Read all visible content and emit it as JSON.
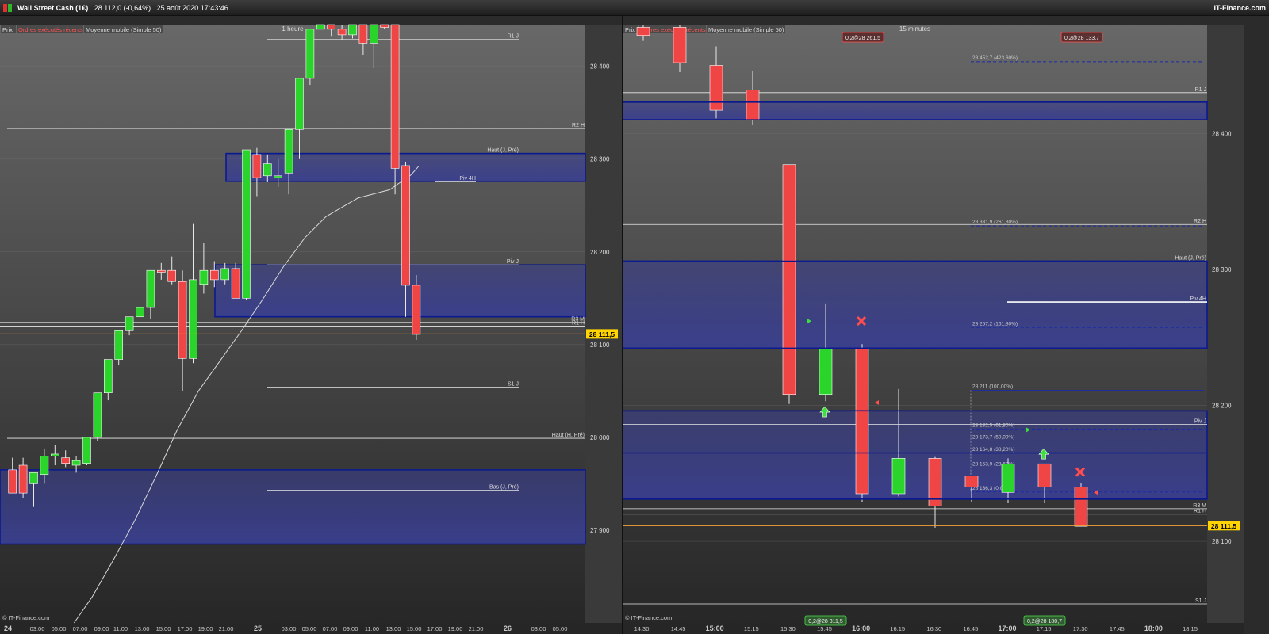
{
  "header": {
    "instrument": "Wall Street Cash (1€)",
    "price": "28 112,0",
    "change": "(-0,64%)",
    "datetime": "25 août 2020 17:43:46",
    "brand": "IT-Finance.com"
  },
  "colors": {
    "up": "#2bd42b",
    "down": "#f04545",
    "band": "#3a3f90",
    "pivot_line": "#0c1a8f",
    "last_price": "#f5a23a",
    "price_tag": "#ffd400"
  },
  "watermark": "© IT-Finance.com",
  "chart_data": [
    {
      "type": "candlestick",
      "title": "1 heure",
      "legend": [
        "Prix",
        "Ordres exécutés récents",
        "Moyenne mobile (Simple 50)"
      ],
      "last_price_label": "28 111,5",
      "y_ticks": [
        27900,
        28000,
        28100,
        28200,
        28300,
        28400
      ],
      "y_tick_labels": [
        "27 900",
        "28 000",
        "28 100",
        "28 200",
        "28 300",
        "28 400"
      ],
      "ylim": [
        27800,
        28445
      ],
      "x_tick_labels": [
        "24",
        "03:00",
        "05:00",
        "07:00",
        "09:00",
        "11:00",
        "13:00",
        "15:00",
        "17:00",
        "19:00",
        "21:00",
        "25",
        "03:00",
        "05:00",
        "07:00",
        "09:00",
        "11:00",
        "13:00",
        "15:00",
        "17:00",
        "19:00",
        "21:00",
        "26",
        "03:00",
        "05:00"
      ],
      "candles": [
        {
          "o": 27965,
          "h": 27978,
          "l": 27942,
          "c": 27940
        },
        {
          "o": 27970,
          "h": 27978,
          "l": 27935,
          "c": 27940
        },
        {
          "o": 27950,
          "h": 27962,
          "l": 27925,
          "c": 27962
        },
        {
          "o": 27960,
          "h": 27988,
          "l": 27950,
          "c": 27980
        },
        {
          "o": 27980,
          "h": 27992,
          "l": 27970,
          "c": 27982
        },
        {
          "o": 27978,
          "h": 27986,
          "l": 27968,
          "c": 27972
        },
        {
          "o": 27970,
          "h": 27980,
          "l": 27962,
          "c": 27975
        },
        {
          "o": 27972,
          "h": 28000,
          "l": 27970,
          "c": 28000
        },
        {
          "o": 28000,
          "h": 28020,
          "l": 27996,
          "c": 28048
        },
        {
          "o": 28048,
          "h": 28060,
          "l": 28040,
          "c": 28084
        },
        {
          "o": 28084,
          "h": 28100,
          "l": 28078,
          "c": 28115
        },
        {
          "o": 28115,
          "h": 28130,
          "l": 28110,
          "c": 28130
        },
        {
          "o": 28130,
          "h": 28145,
          "l": 28120,
          "c": 28140
        },
        {
          "o": 28140,
          "h": 28175,
          "l": 28128,
          "c": 28180
        },
        {
          "o": 28180,
          "h": 28188,
          "l": 28170,
          "c": 28178
        },
        {
          "o": 28180,
          "h": 28195,
          "l": 28165,
          "c": 28168
        },
        {
          "o": 28168,
          "h": 28180,
          "l": 28050,
          "c": 28085
        },
        {
          "o": 28085,
          "h": 28230,
          "l": 28080,
          "c": 28170
        },
        {
          "o": 28165,
          "h": 28210,
          "l": 28155,
          "c": 28180
        },
        {
          "o": 28180,
          "h": 28190,
          "l": 28162,
          "c": 28170
        },
        {
          "o": 28170,
          "h": 28188,
          "l": 28165,
          "c": 28182
        },
        {
          "o": 28182,
          "h": 28188,
          "l": 28160,
          "c": 28150
        },
        {
          "o": 28150,
          "h": 28310,
          "l": 28148,
          "c": 28310
        },
        {
          "o": 28305,
          "h": 28312,
          "l": 28260,
          "c": 28280
        },
        {
          "o": 28282,
          "h": 28305,
          "l": 28275,
          "c": 28295
        },
        {
          "o": 28280,
          "h": 28300,
          "l": 28270,
          "c": 28282
        },
        {
          "o": 28285,
          "h": 28332,
          "l": 28262,
          "c": 28332
        },
        {
          "o": 28332,
          "h": 28340,
          "l": 28300,
          "c": 28387
        },
        {
          "o": 28387,
          "h": 28440,
          "l": 28380,
          "c": 28440
        },
        {
          "o": 28440,
          "h": 28445,
          "l": 28440,
          "c": 28445
        },
        {
          "o": 28445,
          "h": 28445,
          "l": 28432,
          "c": 28440
        },
        {
          "o": 28440,
          "h": 28445,
          "l": 28428,
          "c": 28434
        },
        {
          "o": 28434,
          "h": 28445,
          "l": 28430,
          "c": 28445
        },
        {
          "o": 28445,
          "h": 28445,
          "l": 28412,
          "c": 28425
        },
        {
          "o": 28425,
          "h": 28445,
          "l": 28398,
          "c": 28445
        },
        {
          "o": 28445,
          "h": 28445,
          "l": 28440,
          "c": 28442
        },
        {
          "o": 28445,
          "h": 28445,
          "l": 28262,
          "c": 28290
        },
        {
          "o": 28293,
          "h": 28297,
          "l": 28130,
          "c": 28164
        },
        {
          "o": 28164,
          "h": 28175,
          "l": 28105,
          "c": 28111
        }
      ],
      "moving_average": [
        [
          6.3,
          27800
        ],
        [
          8,
          27828
        ],
        [
          10,
          27868
        ],
        [
          12,
          27910
        ],
        [
          14,
          27958
        ],
        [
          16,
          28008
        ],
        [
          18,
          28050
        ],
        [
          20,
          28082
        ],
        [
          22,
          28114
        ],
        [
          24,
          28148
        ],
        [
          26,
          28184
        ],
        [
          28,
          28215
        ],
        [
          30,
          28238
        ],
        [
          33,
          28258
        ],
        [
          36,
          28267
        ],
        [
          38,
          28283
        ],
        [
          38.7,
          28292
        ]
      ],
      "levels": [
        {
          "label": "R1 J",
          "value": 28429
        },
        {
          "label": "R2 H",
          "value": 28333
        },
        {
          "label": "Haut (J, Pré)",
          "value": 28306
        },
        {
          "label": "Piv 4H",
          "value": 28276
        },
        {
          "label": "Piv J",
          "value": 28186
        },
        {
          "label": "R3 M",
          "value": 28124
        },
        {
          "label": "R1 H",
          "value": 28120
        },
        {
          "label": "S1 J",
          "value": 28054
        },
        {
          "label": "Haut (H, Pré)",
          "value": 27999
        },
        {
          "label": "Bas (J, Pré)",
          "value": 27943
        }
      ]
    },
    {
      "type": "candlestick",
      "title": "15 minutes",
      "legend": [
        "Prix",
        "Ordres exécutés récents",
        "Moyenne mobile (Simple 50)"
      ],
      "last_price_label": "28 111,5",
      "y_ticks": [
        28100,
        28200,
        28300,
        28400
      ],
      "y_tick_labels": [
        "28 100",
        "28 200",
        "28 300",
        "28 400"
      ],
      "ylim": [
        28040,
        28480
      ],
      "x_tick_labels": [
        "14:30",
        "14:45",
        "15:00",
        "15:15",
        "15:30",
        "15:45",
        "16:00",
        "16:15",
        "16:30",
        "16:45",
        "17:00",
        "17:15",
        "17:30",
        "17:45",
        "18:00",
        "18:15"
      ],
      "candles": [
        {
          "o": 28478,
          "h": 28480,
          "l": 28468,
          "c": 28472
        },
        {
          "o": 28478,
          "h": 28480,
          "l": 28445,
          "c": 28452
        },
        {
          "o": 28450,
          "h": 28464,
          "l": 28411,
          "c": 28417
        },
        {
          "o": 28432,
          "h": 28446,
          "l": 28406,
          "c": 28410
        },
        {
          "o": 28377,
          "h": 28377,
          "l": 28201,
          "c": 28208
        },
        {
          "o": 28208,
          "h": 28275,
          "l": 28203,
          "c": 28242
        },
        {
          "o": 28242,
          "h": 28245,
          "l": 28129,
          "c": 28135
        },
        {
          "o": 28135,
          "h": 28212,
          "l": 28133,
          "c": 28161
        },
        {
          "o": 28161,
          "h": 28162,
          "l": 28110,
          "c": 28126
        },
        {
          "o": 28148,
          "h": 28148,
          "l": 28129,
          "c": 28140
        },
        {
          "o": 28136,
          "h": 28161,
          "l": 28128,
          "c": 28157
        },
        {
          "o": 28157,
          "h": 28157,
          "l": 28128,
          "c": 28140
        },
        {
          "o": 28140,
          "h": 28143,
          "l": 28111,
          "c": 28111
        }
      ],
      "candle_slots": [
        0.5,
        1.5,
        2.5,
        3.5,
        4.5,
        5.5,
        6.5,
        7.5,
        8.5,
        9.5,
        10.5,
        11.5,
        12.5
      ],
      "fibonacci": [
        {
          "label": "28 452,7 (423,60%)",
          "value": 28452.7
        },
        {
          "label": "28 331,9 (261,80%)",
          "value": 28331.9
        },
        {
          "label": "28 257,2 (161,80%)",
          "value": 28257.2
        },
        {
          "label": "28 211 (100,00%)",
          "value": 28211
        },
        {
          "label": "28 182,5 (61,80%)",
          "value": 28182.5
        },
        {
          "label": "28 173,7 (50,00%)",
          "value": 28173.7
        },
        {
          "label": "28 164,8 (38,20%)",
          "value": 28164.8
        },
        {
          "label": "28 153,9 (23,60%)",
          "value": 28153.9
        },
        {
          "label": "28 136,3 (0,00%)",
          "value": 28136.3
        }
      ],
      "levels": [
        {
          "label": "R1 J",
          "value": 28430
        },
        {
          "label": "R2 H",
          "value": 28333
        },
        {
          "label": "Haut (J, Pré)",
          "value": 28306
        },
        {
          "label": "Piv 4H",
          "value": 28276
        },
        {
          "label": "Piv J",
          "value": 28186
        },
        {
          "label": "R3 M",
          "value": 28124
        },
        {
          "label": "R1 H",
          "value": 28120
        },
        {
          "label": "S1 J",
          "value": 28054
        }
      ],
      "orders": [
        {
          "label": "0,2@28 261,5",
          "side": "sell"
        },
        {
          "label": "0,2@28 133,7",
          "side": "sell"
        },
        {
          "label": "0,2@28 311,5",
          "side": "buy"
        },
        {
          "label": "0,2@28 180,7",
          "side": "buy"
        }
      ]
    }
  ]
}
